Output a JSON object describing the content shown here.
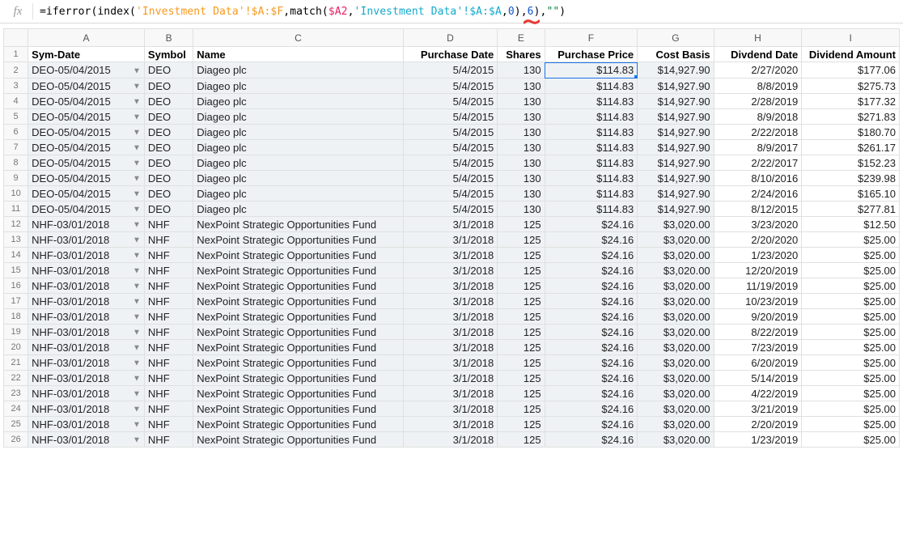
{
  "formula_bar": {
    "fx_label": "fx",
    "tokens": {
      "eq": "=",
      "iferror": "iferror",
      "open1": "(",
      "index": "index",
      "open2": "(",
      "sheet1": "'Investment Data'",
      "bang1": "!",
      "range1": "$A:$F",
      "comma1": ",",
      "match": "match",
      "open3": "(",
      "cellref": "$A2",
      "comma2": ",",
      "sheet2": "'Investment Data'",
      "bang2": "!",
      "range2": "$A:$A",
      "comma3": ",",
      "zero": "0",
      "close1": ")",
      "comma4": ",",
      "six": "6",
      "close2": ")",
      "comma5": ",",
      "emptystr": "\"\"",
      "close3": ")"
    }
  },
  "column_letters": [
    "A",
    "B",
    "C",
    "D",
    "E",
    "F",
    "G",
    "H",
    "I"
  ],
  "headers": {
    "A": "Sym-Date",
    "B": "Symbol",
    "C": "Name",
    "D": "Purchase Date",
    "E": "Shares",
    "F": "Purchase Price",
    "G": "Cost Basis",
    "H": "Divdend Date",
    "I": "Dividend Amount"
  },
  "active_cell": "F2",
  "rows": [
    {
      "n": "2",
      "symdate": "DEO-05/04/2015",
      "symbol": "DEO",
      "name": "Diageo plc",
      "pdate": "5/4/2015",
      "shares": "130",
      "pprice": "$114.83",
      "basis": "$14,927.90",
      "ddate": "2/27/2020",
      "damt": "$177.06"
    },
    {
      "n": "3",
      "symdate": "DEO-05/04/2015",
      "symbol": "DEO",
      "name": "Diageo plc",
      "pdate": "5/4/2015",
      "shares": "130",
      "pprice": "$114.83",
      "basis": "$14,927.90",
      "ddate": "8/8/2019",
      "damt": "$275.73"
    },
    {
      "n": "4",
      "symdate": "DEO-05/04/2015",
      "symbol": "DEO",
      "name": "Diageo plc",
      "pdate": "5/4/2015",
      "shares": "130",
      "pprice": "$114.83",
      "basis": "$14,927.90",
      "ddate": "2/28/2019",
      "damt": "$177.32"
    },
    {
      "n": "5",
      "symdate": "DEO-05/04/2015",
      "symbol": "DEO",
      "name": "Diageo plc",
      "pdate": "5/4/2015",
      "shares": "130",
      "pprice": "$114.83",
      "basis": "$14,927.90",
      "ddate": "8/9/2018",
      "damt": "$271.83"
    },
    {
      "n": "6",
      "symdate": "DEO-05/04/2015",
      "symbol": "DEO",
      "name": "Diageo plc",
      "pdate": "5/4/2015",
      "shares": "130",
      "pprice": "$114.83",
      "basis": "$14,927.90",
      "ddate": "2/22/2018",
      "damt": "$180.70"
    },
    {
      "n": "7",
      "symdate": "DEO-05/04/2015",
      "symbol": "DEO",
      "name": "Diageo plc",
      "pdate": "5/4/2015",
      "shares": "130",
      "pprice": "$114.83",
      "basis": "$14,927.90",
      "ddate": "8/9/2017",
      "damt": "$261.17"
    },
    {
      "n": "8",
      "symdate": "DEO-05/04/2015",
      "symbol": "DEO",
      "name": "Diageo plc",
      "pdate": "5/4/2015",
      "shares": "130",
      "pprice": "$114.83",
      "basis": "$14,927.90",
      "ddate": "2/22/2017",
      "damt": "$152.23"
    },
    {
      "n": "9",
      "symdate": "DEO-05/04/2015",
      "symbol": "DEO",
      "name": "Diageo plc",
      "pdate": "5/4/2015",
      "shares": "130",
      "pprice": "$114.83",
      "basis": "$14,927.90",
      "ddate": "8/10/2016",
      "damt": "$239.98"
    },
    {
      "n": "10",
      "symdate": "DEO-05/04/2015",
      "symbol": "DEO",
      "name": "Diageo plc",
      "pdate": "5/4/2015",
      "shares": "130",
      "pprice": "$114.83",
      "basis": "$14,927.90",
      "ddate": "2/24/2016",
      "damt": "$165.10"
    },
    {
      "n": "11",
      "symdate": "DEO-05/04/2015",
      "symbol": "DEO",
      "name": "Diageo plc",
      "pdate": "5/4/2015",
      "shares": "130",
      "pprice": "$114.83",
      "basis": "$14,927.90",
      "ddate": "8/12/2015",
      "damt": "$277.81"
    },
    {
      "n": "12",
      "symdate": "NHF-03/01/2018",
      "symbol": "NHF",
      "name": "NexPoint Strategic Opportunities Fund",
      "pdate": "3/1/2018",
      "shares": "125",
      "pprice": "$24.16",
      "basis": "$3,020.00",
      "ddate": "3/23/2020",
      "damt": "$12.50"
    },
    {
      "n": "13",
      "symdate": "NHF-03/01/2018",
      "symbol": "NHF",
      "name": "NexPoint Strategic Opportunities Fund",
      "pdate": "3/1/2018",
      "shares": "125",
      "pprice": "$24.16",
      "basis": "$3,020.00",
      "ddate": "2/20/2020",
      "damt": "$25.00"
    },
    {
      "n": "14",
      "symdate": "NHF-03/01/2018",
      "symbol": "NHF",
      "name": "NexPoint Strategic Opportunities Fund",
      "pdate": "3/1/2018",
      "shares": "125",
      "pprice": "$24.16",
      "basis": "$3,020.00",
      "ddate": "1/23/2020",
      "damt": "$25.00"
    },
    {
      "n": "15",
      "symdate": "NHF-03/01/2018",
      "symbol": "NHF",
      "name": "NexPoint Strategic Opportunities Fund",
      "pdate": "3/1/2018",
      "shares": "125",
      "pprice": "$24.16",
      "basis": "$3,020.00",
      "ddate": "12/20/2019",
      "damt": "$25.00"
    },
    {
      "n": "16",
      "symdate": "NHF-03/01/2018",
      "symbol": "NHF",
      "name": "NexPoint Strategic Opportunities Fund",
      "pdate": "3/1/2018",
      "shares": "125",
      "pprice": "$24.16",
      "basis": "$3,020.00",
      "ddate": "11/19/2019",
      "damt": "$25.00"
    },
    {
      "n": "17",
      "symdate": "NHF-03/01/2018",
      "symbol": "NHF",
      "name": "NexPoint Strategic Opportunities Fund",
      "pdate": "3/1/2018",
      "shares": "125",
      "pprice": "$24.16",
      "basis": "$3,020.00",
      "ddate": "10/23/2019",
      "damt": "$25.00"
    },
    {
      "n": "18",
      "symdate": "NHF-03/01/2018",
      "symbol": "NHF",
      "name": "NexPoint Strategic Opportunities Fund",
      "pdate": "3/1/2018",
      "shares": "125",
      "pprice": "$24.16",
      "basis": "$3,020.00",
      "ddate": "9/20/2019",
      "damt": "$25.00"
    },
    {
      "n": "19",
      "symdate": "NHF-03/01/2018",
      "symbol": "NHF",
      "name": "NexPoint Strategic Opportunities Fund",
      "pdate": "3/1/2018",
      "shares": "125",
      "pprice": "$24.16",
      "basis": "$3,020.00",
      "ddate": "8/22/2019",
      "damt": "$25.00"
    },
    {
      "n": "20",
      "symdate": "NHF-03/01/2018",
      "symbol": "NHF",
      "name": "NexPoint Strategic Opportunities Fund",
      "pdate": "3/1/2018",
      "shares": "125",
      "pprice": "$24.16",
      "basis": "$3,020.00",
      "ddate": "7/23/2019",
      "damt": "$25.00"
    },
    {
      "n": "21",
      "symdate": "NHF-03/01/2018",
      "symbol": "NHF",
      "name": "NexPoint Strategic Opportunities Fund",
      "pdate": "3/1/2018",
      "shares": "125",
      "pprice": "$24.16",
      "basis": "$3,020.00",
      "ddate": "6/20/2019",
      "damt": "$25.00"
    },
    {
      "n": "22",
      "symdate": "NHF-03/01/2018",
      "symbol": "NHF",
      "name": "NexPoint Strategic Opportunities Fund",
      "pdate": "3/1/2018",
      "shares": "125",
      "pprice": "$24.16",
      "basis": "$3,020.00",
      "ddate": "5/14/2019",
      "damt": "$25.00"
    },
    {
      "n": "23",
      "symdate": "NHF-03/01/2018",
      "symbol": "NHF",
      "name": "NexPoint Strategic Opportunities Fund",
      "pdate": "3/1/2018",
      "shares": "125",
      "pprice": "$24.16",
      "basis": "$3,020.00",
      "ddate": "4/22/2019",
      "damt": "$25.00"
    },
    {
      "n": "24",
      "symdate": "NHF-03/01/2018",
      "symbol": "NHF",
      "name": "NexPoint Strategic Opportunities Fund",
      "pdate": "3/1/2018",
      "shares": "125",
      "pprice": "$24.16",
      "basis": "$3,020.00",
      "ddate": "3/21/2019",
      "damt": "$25.00"
    },
    {
      "n": "25",
      "symdate": "NHF-03/01/2018",
      "symbol": "NHF",
      "name": "NexPoint Strategic Opportunities Fund",
      "pdate": "3/1/2018",
      "shares": "125",
      "pprice": "$24.16",
      "basis": "$3,020.00",
      "ddate": "2/20/2019",
      "damt": "$25.00"
    },
    {
      "n": "26",
      "symdate": "NHF-03/01/2018",
      "symbol": "NHF",
      "name": "NexPoint Strategic Opportunities Fund",
      "pdate": "3/1/2018",
      "shares": "125",
      "pprice": "$24.16",
      "basis": "$3,020.00",
      "ddate": "1/23/2019",
      "damt": "$25.00"
    }
  ]
}
